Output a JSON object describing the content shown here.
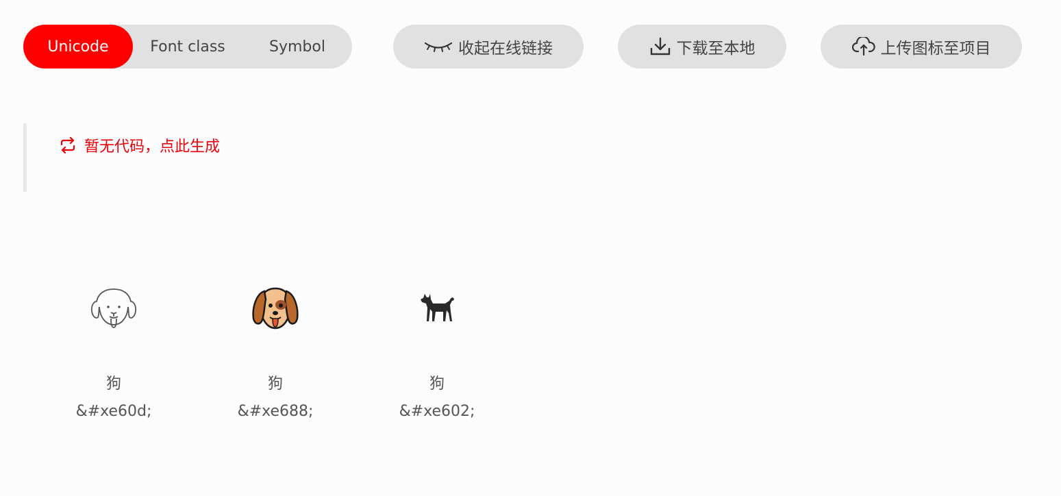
{
  "tabs": [
    {
      "label": "Unicode",
      "active": true
    },
    {
      "label": "Font class",
      "active": false
    },
    {
      "label": "Symbol",
      "active": false
    }
  ],
  "actions": {
    "collapse_label": "收起在线链接",
    "download_label": "下载至本地",
    "upload_label": "上传图标至项目"
  },
  "code_area": {
    "generate_label": "暂无代码，点此生成"
  },
  "icons": [
    {
      "name": "狗",
      "code": "&#xe60d;",
      "icon": "dog-outline-icon"
    },
    {
      "name": "狗",
      "code": "&#xe688;",
      "icon": "dog-face-color-icon"
    },
    {
      "name": "狗",
      "code": "&#xe602;",
      "icon": "dog-silhouette-icon"
    }
  ],
  "colors": {
    "accent": "#ff0000",
    "pill_bg": "#e1e1e1",
    "link_red": "#e8000b",
    "page_bg": "#fcfcfc"
  }
}
